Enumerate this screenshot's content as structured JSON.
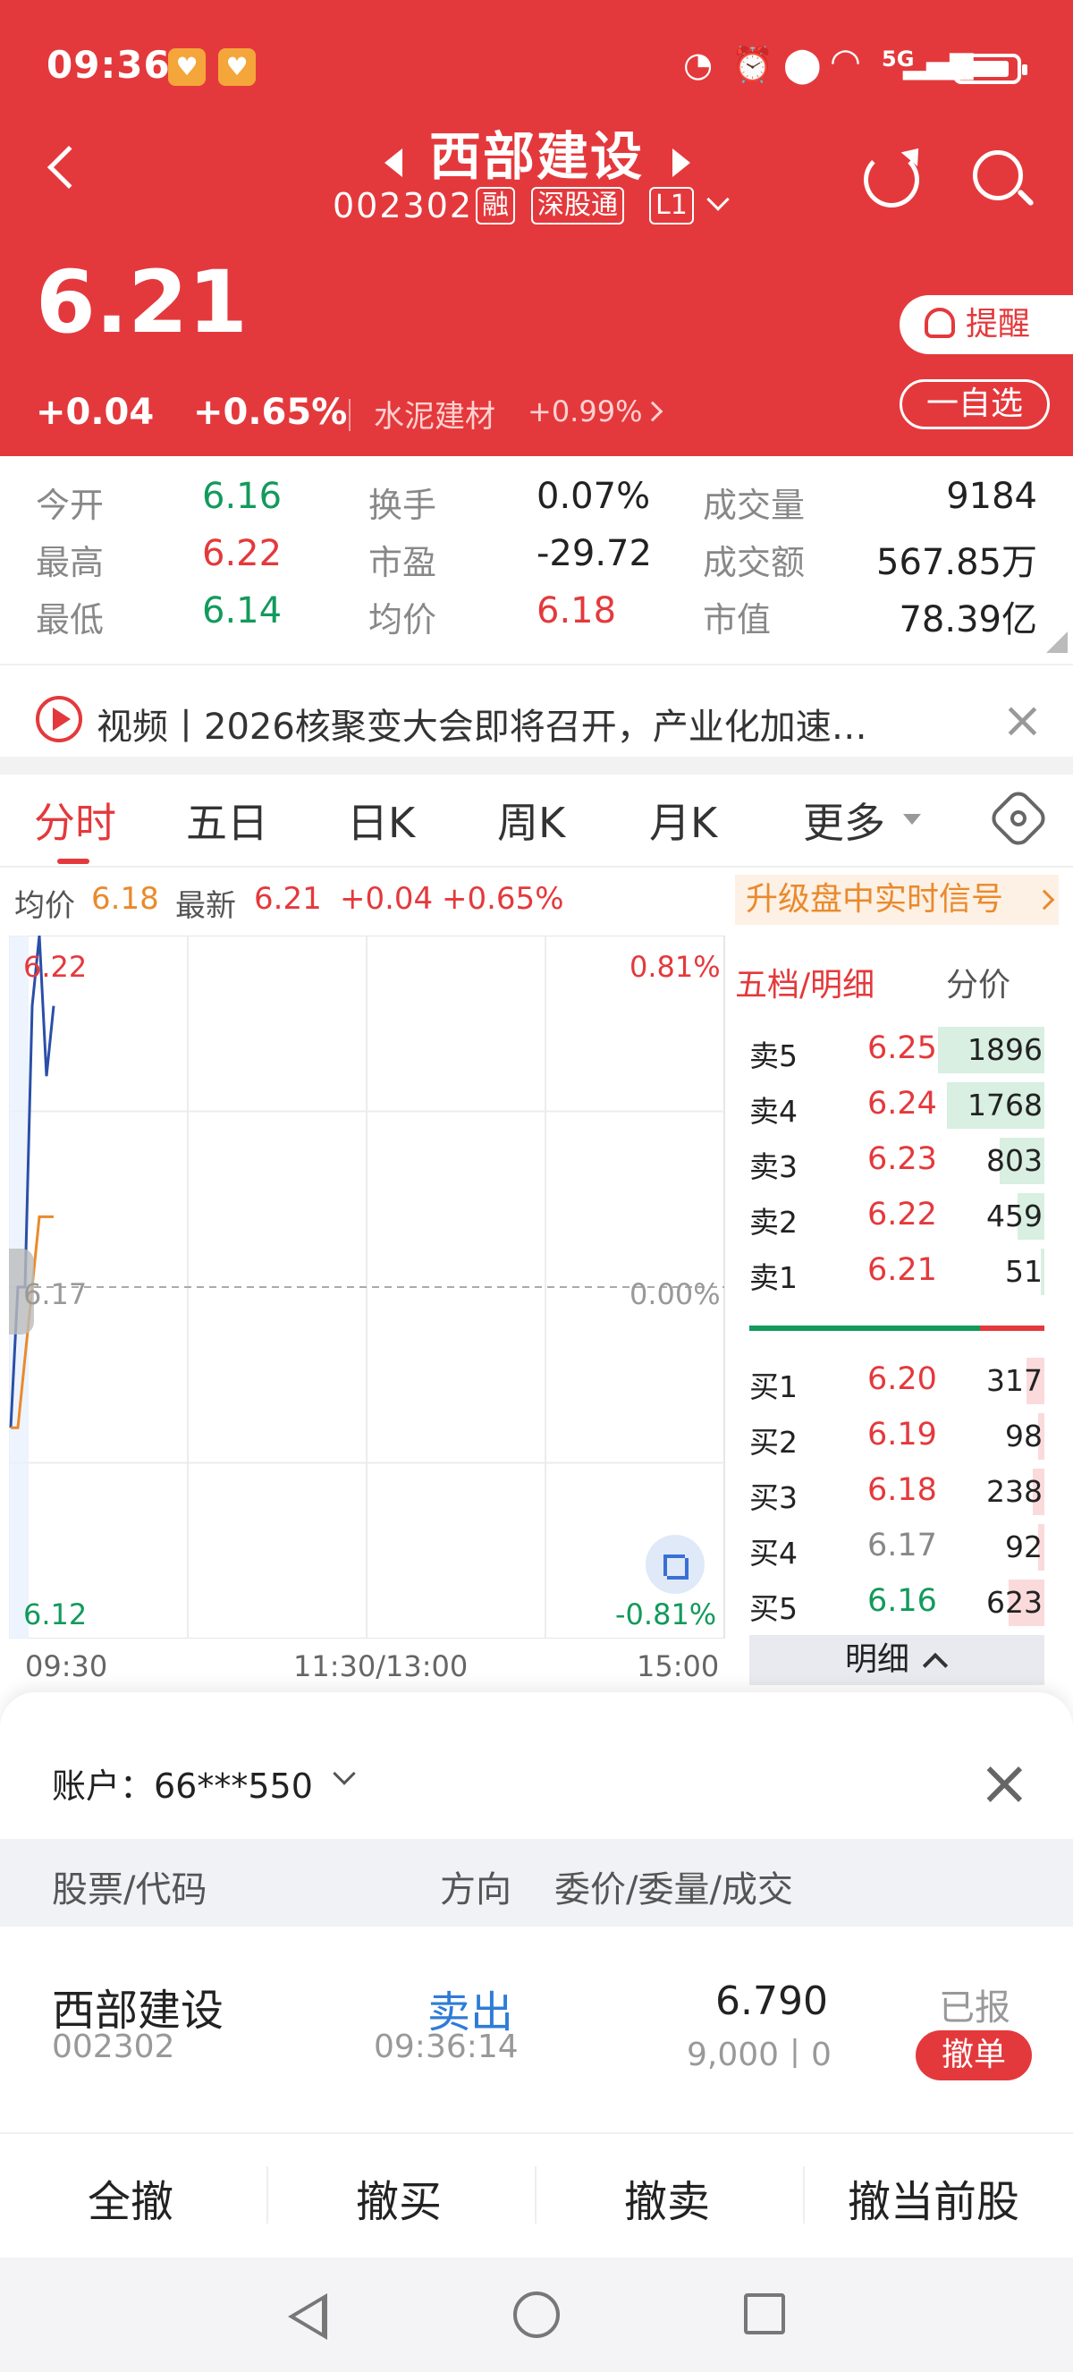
{
  "status_bar": {
    "time": "09:36",
    "network": "5G"
  },
  "header": {
    "stock_name": "西部建设",
    "stock_code": "002302",
    "tags": [
      "融",
      "深股通",
      "L1"
    ],
    "price": "6.21",
    "change": "+0.04",
    "change_pct": "+0.65%",
    "sector_name": "水泥建材",
    "sector_pct": "+0.99%",
    "remind_label": "提醒",
    "watchlist_label": "一自选"
  },
  "stats": [
    {
      "label": "今开",
      "value": "6.16",
      "color": "#139a5c"
    },
    {
      "label": "换手",
      "value": "0.07%",
      "color": "#222"
    },
    {
      "label": "成交量",
      "value": "9184",
      "color": "#222"
    },
    {
      "label": "最高",
      "value": "6.22",
      "color": "#e4393c"
    },
    {
      "label": "市盈",
      "value": "-29.72",
      "color": "#222"
    },
    {
      "label": "成交额",
      "value": "567.85万",
      "color": "#222"
    },
    {
      "label": "最低",
      "value": "6.14",
      "color": "#139a5c"
    },
    {
      "label": "均价",
      "value": "6.18",
      "color": "#e4393c"
    },
    {
      "label": "市值",
      "value": "78.39亿",
      "color": "#222"
    }
  ],
  "news": {
    "text": "视频丨2026核聚变大会即将召开，产业化加速…"
  },
  "tabs": [
    "分时",
    "五日",
    "日K",
    "周K",
    "月K",
    "更多"
  ],
  "minute_info": {
    "avg_label": "均价",
    "avg_value": "6.18",
    "latest_label": "最新",
    "latest_value": "6.21",
    "change": "+0.04",
    "change_pct": "+0.65%",
    "upgrade_label": "升级盘中实时信号"
  },
  "chart_data": {
    "type": "line",
    "y_left_ticks": [
      "6.22",
      "6.17",
      "6.12"
    ],
    "y_right_ticks": [
      "0.81%",
      "0.00%",
      "-0.81%"
    ],
    "x_ticks": [
      "09:30",
      "11:30/13:00",
      "15:00"
    ],
    "ylim": [
      6.12,
      6.22
    ],
    "prev_close": 6.17,
    "series": [
      {
        "name": "最新",
        "color": "#2a4fa8",
        "x": [
          0,
          1,
          2,
          3,
          4,
          5,
          6
        ],
        "values": [
          6.15,
          6.17,
          6.17,
          6.21,
          6.22,
          6.2,
          6.21
        ]
      },
      {
        "name": "均价",
        "color": "#e98a2c",
        "x": [
          0,
          1,
          2,
          3,
          4,
          5,
          6
        ],
        "values": [
          6.15,
          6.15,
          6.16,
          6.17,
          6.18,
          6.18,
          6.18
        ]
      }
    ]
  },
  "order_book": {
    "header_left": "五档/明细",
    "header_right": "分价",
    "asks": [
      {
        "label": "卖5",
        "price": "6.25",
        "volume": "1896",
        "bar": 0.36,
        "price_color": "#e4393c"
      },
      {
        "label": "卖4",
        "price": "6.24",
        "volume": "1768",
        "bar": 0.33,
        "price_color": "#e4393c"
      },
      {
        "label": "卖3",
        "price": "6.23",
        "volume": "803",
        "bar": 0.15,
        "price_color": "#e4393c"
      },
      {
        "label": "卖2",
        "price": "6.22",
        "volume": "459",
        "bar": 0.09,
        "price_color": "#e4393c"
      },
      {
        "label": "卖1",
        "price": "6.21",
        "volume": "51",
        "bar": 0.01,
        "price_color": "#e4393c"
      }
    ],
    "bids": [
      {
        "label": "买1",
        "price": "6.20",
        "volume": "317",
        "bar": 0.06,
        "price_color": "#e4393c"
      },
      {
        "label": "买2",
        "price": "6.19",
        "volume": "98",
        "bar": 0.02,
        "price_color": "#e4393c"
      },
      {
        "label": "买3",
        "price": "6.18",
        "volume": "238",
        "bar": 0.04,
        "price_color": "#e4393c"
      },
      {
        "label": "买4",
        "price": "6.17",
        "volume": "92",
        "bar": 0.02,
        "price_color": "#888888"
      },
      {
        "label": "买5",
        "price": "6.16",
        "volume": "623",
        "bar": 0.12,
        "price_color": "#139a5c"
      }
    ],
    "detail_label": "明细"
  },
  "order_sheet": {
    "account_label": "账户：66***550",
    "columns": [
      "股票/代码",
      "方向",
      "委价/委量/成交"
    ],
    "order": {
      "name": "西部建设",
      "code": "002302",
      "direction": "卖出",
      "time": "09:36:14",
      "price": "6.790",
      "qty": "9,000丨0",
      "status": "已报",
      "cancel_label": "撤单"
    },
    "actions": [
      "全撤",
      "撤买",
      "撤卖",
      "撤当前股"
    ]
  },
  "colors": {
    "brand_red": "#e4393c",
    "up": "#e4393c",
    "down": "#139a5c",
    "accent_blue": "#2f7cd6"
  }
}
